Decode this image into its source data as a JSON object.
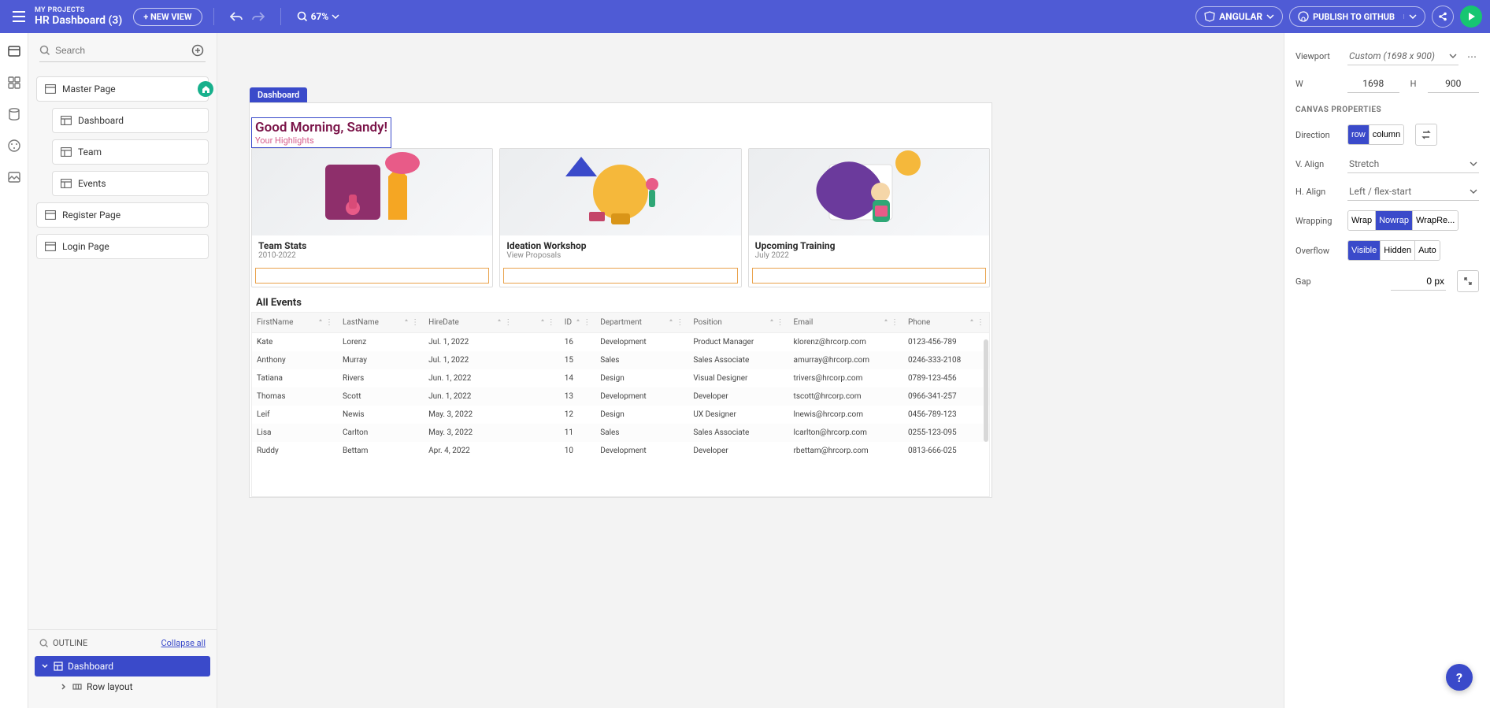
{
  "header": {
    "my_projects": "MY PROJECTS",
    "project_title": "HR Dashboard (3)",
    "new_view": "+ NEW VIEW",
    "zoom": "67%",
    "framework": "ANGULAR",
    "publish": "PUBLISH TO GITHUB"
  },
  "sidepanel": {
    "search_placeholder": "Search",
    "pages": {
      "master": "Master Page",
      "dashboard": "Dashboard",
      "team": "Team",
      "events": "Events",
      "register": "Register Page",
      "login": "Login Page"
    },
    "outline_label": "OUTLINE",
    "collapse_all": "Collapse all",
    "outline_items": {
      "dashboard": "Dashboard",
      "row_layout": "Row layout"
    }
  },
  "canvas": {
    "frame_tab": "Dashboard",
    "greeting": "Good Morning, Sandy!",
    "subgreeting": "Your Highlights",
    "cards": [
      {
        "title": "Team Stats",
        "sub": "2010-2022"
      },
      {
        "title": "Ideation Workshop",
        "sub": "View Proposals"
      },
      {
        "title": "Upcoming Training",
        "sub": "July 2022"
      }
    ],
    "all_events": "All Events",
    "table": {
      "columns": [
        "FirstName",
        "LastName",
        "HireDate",
        "",
        "ID",
        "Department",
        "Position",
        "Email",
        "Phone"
      ],
      "rows": [
        [
          "Kate",
          "Lorenz",
          "Jul. 1, 2022",
          "",
          "16",
          "Development",
          "Product Manager",
          "klorenz@hrcorp.com",
          "0123-456-789"
        ],
        [
          "Anthony",
          "Murray",
          "Jul. 1, 2022",
          "",
          "15",
          "Sales",
          "Sales Associate",
          "amurray@hrcorp.com",
          "0246-333-2108"
        ],
        [
          "Tatiana",
          "Rivers",
          "Jun. 1, 2022",
          "",
          "14",
          "Design",
          "Visual Designer",
          "trivers@hrcorp.com",
          "0789-123-456"
        ],
        [
          "Thomas",
          "Scott",
          "Jun. 1, 2022",
          "",
          "13",
          "Development",
          "Developer",
          "tscott@hrcorp.com",
          "0966-341-257"
        ],
        [
          "Leif",
          "Newis",
          "May. 3, 2022",
          "",
          "12",
          "Design",
          "UX Designer",
          "lnewis@hrcorp.com",
          "0456-789-123"
        ],
        [
          "Lisa",
          "Carlton",
          "May. 3, 2022",
          "",
          "11",
          "Sales",
          "Sales Associate",
          "lcarlton@hrcorp.com",
          "0255-123-095"
        ],
        [
          "Ruddy",
          "Bettam",
          "Apr. 4, 2022",
          "",
          "10",
          "Development",
          "Developer",
          "rbettam@hrcorp.com",
          "0813-666-025"
        ]
      ]
    }
  },
  "rightpanel": {
    "viewport_lbl": "Viewport",
    "viewport_val": "Custom (1698 x 900)",
    "w_lbl": "W",
    "w_val": "1698",
    "h_lbl": "H",
    "h_val": "900",
    "section": "CANVAS PROPERTIES",
    "direction_lbl": "Direction",
    "direction_opts": {
      "row": "row",
      "column": "column"
    },
    "valign_lbl": "V. Align",
    "valign_val": "Stretch",
    "halign_lbl": "H. Align",
    "halign_val": "Left / flex-start",
    "wrapping_lbl": "Wrapping",
    "wrapping_opts": {
      "wrap": "Wrap",
      "nowrap": "Nowrap",
      "wrapre": "WrapRe..."
    },
    "overflow_lbl": "Overflow",
    "overflow_opts": {
      "visible": "Visible",
      "hidden": "Hidden",
      "auto": "Auto"
    },
    "gap_lbl": "Gap",
    "gap_val": "0 px"
  },
  "help": "?"
}
